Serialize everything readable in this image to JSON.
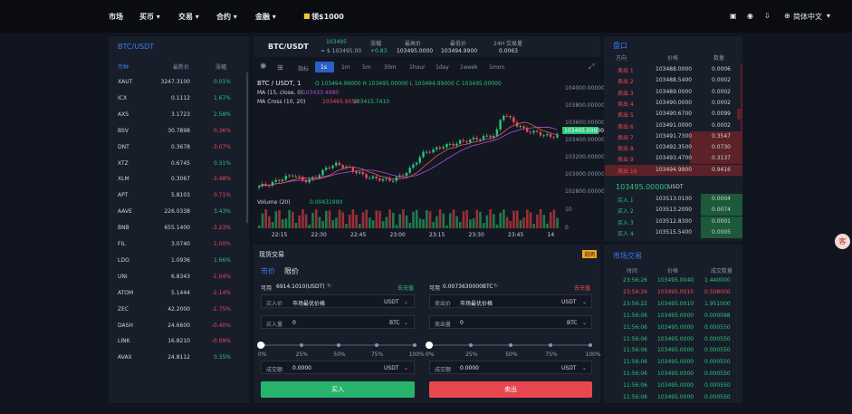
{
  "nav": {
    "items": [
      "市场",
      "买币 ▾",
      "交易 ▾",
      "合约 ▾",
      "金融 ▾"
    ],
    "bonus": "领$1000",
    "lang": "简体中文",
    "lang_caret": "▾"
  },
  "markets": {
    "title": "BTC/USDT",
    "headers": [
      "币种",
      "最新价",
      "涨幅"
    ],
    "rows": [
      [
        "XAUT",
        "3247.3100",
        "0.01%",
        "g"
      ],
      [
        "ICX",
        "0.1112",
        "1.67%",
        "g"
      ],
      [
        "AXS",
        "3.1723",
        "2.58%",
        "g"
      ],
      [
        "BSV",
        "30.7898",
        "0.36%",
        "r"
      ],
      [
        "DNT",
        "0.3678",
        "-3.07%",
        "r"
      ],
      [
        "XTZ",
        "0.6745",
        "0.31%",
        "g"
      ],
      [
        "XLM",
        "0.3067",
        "-3.48%",
        "r"
      ],
      [
        "APT",
        "5.8103",
        "0.71%",
        "r"
      ],
      [
        "AAVE",
        "226.0338",
        "3.43%",
        "g"
      ],
      [
        "BNB",
        "655.1400",
        "-3.23%",
        "r"
      ],
      [
        "FIL",
        "3.0740",
        "1.00%",
        "r"
      ],
      [
        "LDO",
        "1.0936",
        "1.66%",
        "g"
      ],
      [
        "UNI",
        "6.8343",
        "-1.04%",
        "r"
      ],
      [
        "ATOM",
        "5.1444",
        "-2.14%",
        "r"
      ],
      [
        "ZEC",
        "42.2000",
        "-1.75%",
        "r"
      ],
      [
        "DASH",
        "24.6600",
        "-0.40%",
        "r"
      ],
      [
        "LINK",
        "16.8210",
        "-0.09%",
        "r"
      ],
      [
        "AVAX",
        "24.8112",
        "0.35%",
        "g"
      ]
    ]
  },
  "ticker": {
    "pair": "BTC/USDT",
    "price": "103495",
    "price_sub": "≈ $ 103495.00",
    "change_label": "涨幅",
    "change": "+0.83",
    "high_label": "最高价",
    "high": "103495.0000",
    "low_label": "最低价",
    "low": "103494.9900",
    "vol_label": "24H 交易量",
    "vol": "0.0063"
  },
  "chart": {
    "timeframes": [
      "指标",
      "1s",
      "1m",
      "5m",
      "30m",
      "1hour",
      "1day",
      "1week",
      "1mon"
    ],
    "active": "1m",
    "legend1": "BTC / USDT, 1",
    "ohlc": "O 103494.99000  H 103495.00000  L 103494.99000  C 103495.00000",
    "ma_label": "MA (15, close, 0)",
    "ma_val": "103433.4980",
    "macross_label": "MA Cross (10, 20)",
    "mc_v1": "103465.9050",
    "mc_v2": "103415.7410",
    "vol_label": "Volume (20)",
    "vol_val": "0.00431990",
    "price_ticks": [
      "104000.00000",
      "103800.00000",
      "103600.00000",
      "103400.00000",
      "103200.00000",
      "103000.00000",
      "102800.00000"
    ],
    "last_price": "103495.00000",
    "vol_ticks": [
      "10",
      "0"
    ],
    "time_ticks": [
      "22:15",
      "22:30",
      "22:45",
      "23:00",
      "23:15",
      "23:30",
      "23:45",
      "14"
    ]
  },
  "order": {
    "title": "现货交易",
    "badge": "说明",
    "tabs": [
      "市价",
      "限价"
    ],
    "avail_label": "可用",
    "buy_avail": "6914.1010(USDT)",
    "sell_avail": "0.0073630000BTC",
    "recharge": "去充值",
    "price_label": "买入价",
    "sell_price_label": "卖出价",
    "market_text": "市场最优价格",
    "usdt": "USDT",
    "btc": "BTC",
    "buy_amt_label": "买入量",
    "sell_amt_label": "卖出量",
    "zero": "0",
    "pcts": [
      "0%",
      "25%",
      "50%",
      "75%",
      "100%"
    ],
    "total_label": "成交额",
    "total": "0.0000",
    "buy_btn": "买入",
    "sell_btn": "卖出"
  },
  "book": {
    "title": "盘口",
    "headers": [
      "方向",
      "价格",
      "数量"
    ],
    "asks": [
      [
        "卖出 1",
        "103488.0000",
        "0.0006"
      ],
      [
        "卖出 2",
        "103488.5400",
        "0.0002"
      ],
      [
        "卖出 3",
        "103489.0000",
        "0.0002"
      ],
      [
        "卖出 4",
        "103490.0000",
        "0.0002"
      ],
      [
        "卖出 5",
        "103490.6700",
        "0.0099"
      ],
      [
        "卖出 6",
        "103491.0000",
        "0.0002"
      ],
      [
        "卖出 7",
        "103491.7300",
        "0.3547"
      ],
      [
        "卖出 8",
        "103492.3500",
        "0.0730"
      ],
      [
        "卖出 9",
        "103493.4700",
        "0.3137"
      ],
      [
        "卖出 10",
        "103494.9900",
        "0.9416"
      ]
    ],
    "depth_asks": [
      0.01,
      0.01,
      0.01,
      0.01,
      0.04,
      0.01,
      0.38,
      0.38,
      0.38,
      1.0
    ],
    "mid": "103495.00000",
    "mid_unit": "USDT",
    "bids": [
      [
        "买入 1",
        "103513.0100",
        "0.0004"
      ],
      [
        "买入 2",
        "103513.2000",
        "0.0074"
      ],
      [
        "买入 3",
        "103512.8300",
        "0.0001"
      ],
      [
        "买入 4",
        "103515.5400",
        "0.0005"
      ]
    ],
    "depth_bids": [
      0.3,
      0.3,
      0.3,
      0.3
    ]
  },
  "trades": {
    "title": "市场交易",
    "headers": [
      "时间",
      "价格",
      "成交数量"
    ],
    "rows": [
      [
        "23:56:26",
        "103495.0040",
        "1.440000",
        "g"
      ],
      [
        "23:56:26",
        "103495.0010",
        "0.508000",
        "r"
      ],
      [
        "23:56:22",
        "103495.0010",
        "1.951000",
        "g"
      ],
      [
        "11:56:06",
        "103495.0000",
        "0.000098",
        "g"
      ],
      [
        "11:56:06",
        "103495.0000",
        "0.000550",
        "g"
      ],
      [
        "11:56:06",
        "103495.0000",
        "0.000550",
        "g"
      ],
      [
        "11:56:06",
        "103495.0000",
        "0.000550",
        "g"
      ],
      [
        "11:56:06",
        "103495.0000",
        "0.000550",
        "g"
      ],
      [
        "11:56:06",
        "103495.0000",
        "0.000550",
        "g"
      ],
      [
        "11:56:06",
        "103495.0000",
        "0.000550",
        "g"
      ],
      [
        "11:56:06",
        "103495.0000",
        "0.000550",
        "g"
      ]
    ]
  },
  "colors": {
    "up": "#28c67a",
    "down": "#f04a53",
    "accent": "#3d7cf0"
  }
}
